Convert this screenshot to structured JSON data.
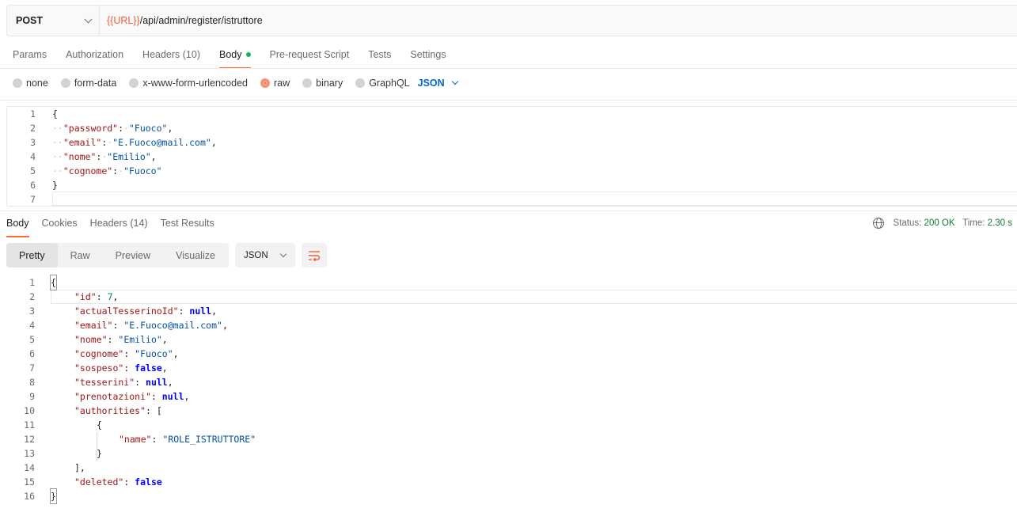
{
  "request": {
    "method": "POST",
    "url_var": "{{URL}}",
    "url_path": "/api/admin/register/istruttore"
  },
  "request_tabs": [
    {
      "label": "Params"
    },
    {
      "label": "Authorization"
    },
    {
      "label": "Headers (10)"
    },
    {
      "label": "Body"
    },
    {
      "label": "Pre-request Script"
    },
    {
      "label": "Tests"
    },
    {
      "label": "Settings"
    }
  ],
  "body_types": [
    {
      "label": "none"
    },
    {
      "label": "form-data"
    },
    {
      "label": "x-www-form-urlencoded"
    },
    {
      "label": "raw"
    },
    {
      "label": "binary"
    },
    {
      "label": "GraphQL"
    }
  ],
  "body_language": "JSON",
  "request_body": {
    "line_numbers": [
      "1",
      "2",
      "3",
      "4",
      "5",
      "6",
      "7"
    ],
    "open": "{",
    "close": "}",
    "fields": [
      {
        "key": "\"password\"",
        "value": "\"Fuoco\"",
        "trail": ","
      },
      {
        "key": "\"email\"",
        "value": "\"E.Fuoco@mail.com\"",
        "trail": ","
      },
      {
        "key": "\"nome\"",
        "value": "\"Emilio\"",
        "trail": ","
      },
      {
        "key": "\"cognome\"",
        "value": "\"Fuoco\"",
        "trail": ""
      }
    ]
  },
  "response_tabs": [
    {
      "label": "Body"
    },
    {
      "label": "Cookies"
    },
    {
      "label": "Headers (14)"
    },
    {
      "label": "Test Results"
    }
  ],
  "status": {
    "status_label": "Status:",
    "status_value": "200 OK",
    "time_label": "Time:",
    "time_value": "2.30 s"
  },
  "view_modes": [
    {
      "label": "Pretty"
    },
    {
      "label": "Raw"
    },
    {
      "label": "Preview"
    },
    {
      "label": "Visualize"
    }
  ],
  "response_format": "JSON",
  "response_body": {
    "line_numbers": [
      "1",
      "2",
      "3",
      "4",
      "5",
      "6",
      "7",
      "8",
      "9",
      "10",
      "11",
      "12",
      "13",
      "14",
      "15",
      "16"
    ],
    "l1": "{",
    "l2k": "\"id\"",
    "l2v": "7",
    "l3k": "\"actualTesserinoId\"",
    "l3v": "null",
    "l4k": "\"email\"",
    "l4v": "\"E.Fuoco@mail.com\"",
    "l5k": "\"nome\"",
    "l5v": "\"Emilio\"",
    "l6k": "\"cognome\"",
    "l6v": "\"Fuoco\"",
    "l7k": "\"sospeso\"",
    "l7v": "false",
    "l8k": "\"tesserini\"",
    "l8v": "null",
    "l9k": "\"prenotazioni\"",
    "l9v": "null",
    "l10k": "\"authorities\"",
    "l10v": "[",
    "l11": "{",
    "l12k": "\"name\"",
    "l12v": "\"ROLE_ISTRUTTORE\"",
    "l13": "}",
    "l14": "],",
    "l15k": "\"deleted\"",
    "l15v": "false",
    "l16": "}"
  }
}
